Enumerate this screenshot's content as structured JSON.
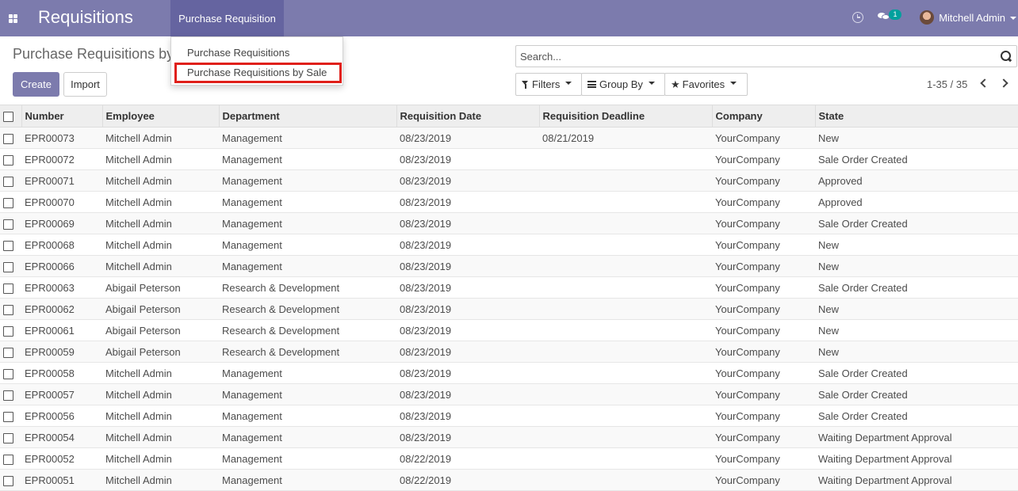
{
  "navbar": {
    "app_title": "Requisitions",
    "active_menu": "Purchase Requisition",
    "chat_badge": "1",
    "user_name": "Mitchell Admin"
  },
  "dropdown": {
    "items": [
      "Purchase Requisitions",
      "Purchase Requisitions by Sale"
    ]
  },
  "control_panel": {
    "breadcrumb": "Purchase Requisitions by",
    "create_label": "Create",
    "import_label": "Import",
    "search_placeholder": "Search...",
    "filters_label": "Filters",
    "group_by_label": "Group By",
    "favorites_label": "Favorites",
    "pager_value": "1-35 / 35"
  },
  "table": {
    "headers": [
      "Number",
      "Employee",
      "Department",
      "Requisition Date",
      "Requisition Deadline",
      "Company",
      "State"
    ],
    "rows": [
      [
        "EPR00073",
        "Mitchell Admin",
        "Management",
        "08/23/2019",
        "08/21/2019",
        "YourCompany",
        "New"
      ],
      [
        "EPR00072",
        "Mitchell Admin",
        "Management",
        "08/23/2019",
        "",
        "YourCompany",
        "Sale Order Created"
      ],
      [
        "EPR00071",
        "Mitchell Admin",
        "Management",
        "08/23/2019",
        "",
        "YourCompany",
        "Approved"
      ],
      [
        "EPR00070",
        "Mitchell Admin",
        "Management",
        "08/23/2019",
        "",
        "YourCompany",
        "Approved"
      ],
      [
        "EPR00069",
        "Mitchell Admin",
        "Management",
        "08/23/2019",
        "",
        "YourCompany",
        "Sale Order Created"
      ],
      [
        "EPR00068",
        "Mitchell Admin",
        "Management",
        "08/23/2019",
        "",
        "YourCompany",
        "New"
      ],
      [
        "EPR00066",
        "Mitchell Admin",
        "Management",
        "08/23/2019",
        "",
        "YourCompany",
        "New"
      ],
      [
        "EPR00063",
        "Abigail Peterson",
        "Research & Development",
        "08/23/2019",
        "",
        "YourCompany",
        "Sale Order Created"
      ],
      [
        "EPR00062",
        "Abigail Peterson",
        "Research & Development",
        "08/23/2019",
        "",
        "YourCompany",
        "New"
      ],
      [
        "EPR00061",
        "Abigail Peterson",
        "Research & Development",
        "08/23/2019",
        "",
        "YourCompany",
        "New"
      ],
      [
        "EPR00059",
        "Abigail Peterson",
        "Research & Development",
        "08/23/2019",
        "",
        "YourCompany",
        "New"
      ],
      [
        "EPR00058",
        "Mitchell Admin",
        "Management",
        "08/23/2019",
        "",
        "YourCompany",
        "Sale Order Created"
      ],
      [
        "EPR00057",
        "Mitchell Admin",
        "Management",
        "08/23/2019",
        "",
        "YourCompany",
        "Sale Order Created"
      ],
      [
        "EPR00056",
        "Mitchell Admin",
        "Management",
        "08/23/2019",
        "",
        "YourCompany",
        "Sale Order Created"
      ],
      [
        "EPR00054",
        "Mitchell Admin",
        "Management",
        "08/23/2019",
        "",
        "YourCompany",
        "Waiting Department Approval"
      ],
      [
        "EPR00052",
        "Mitchell Admin",
        "Management",
        "08/22/2019",
        "",
        "YourCompany",
        "Waiting Department Approval"
      ],
      [
        "EPR00051",
        "Mitchell Admin",
        "Management",
        "08/22/2019",
        "",
        "YourCompany",
        "Waiting Department Approval"
      ]
    ]
  },
  "colors": {
    "navbar": "#7c7bad",
    "navbar_active": "#6564a0",
    "primary_button": "#7c7bad",
    "highlight_box": "#e0201a",
    "chat_badge": "#00a09d"
  },
  "icons": [
    "apps-icon",
    "clock-icon",
    "chat-icon",
    "avatar",
    "search-icon",
    "filter-icon",
    "bars-icon",
    "star-icon",
    "chevron-left-icon",
    "chevron-right-icon"
  ]
}
